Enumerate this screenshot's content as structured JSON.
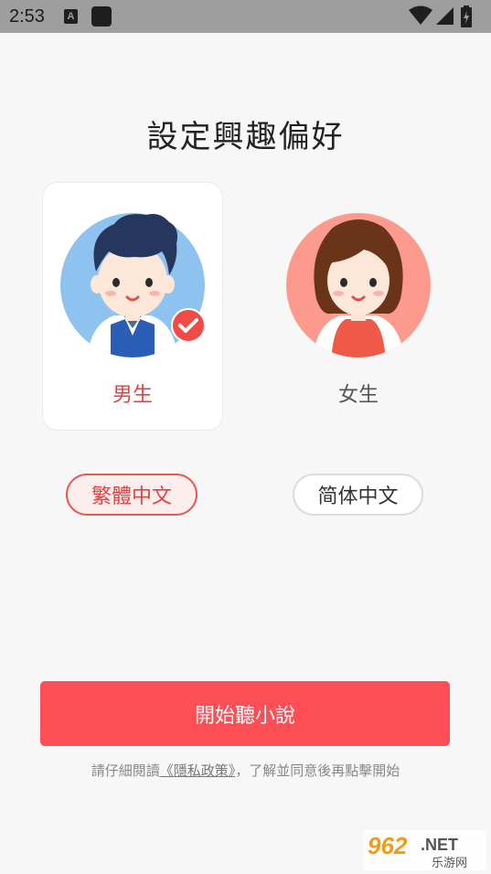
{
  "status_bar": {
    "time": "2:53",
    "notif_letter": "A"
  },
  "page": {
    "title": "設定興趣偏好"
  },
  "gender": {
    "male_label": "男生",
    "female_label": "女生",
    "selected": "male"
  },
  "language": {
    "traditional_label": "繁體中文",
    "simplified_label": "简体中文",
    "selected": "traditional"
  },
  "start_button": {
    "label": "開始聽小說"
  },
  "policy": {
    "prefix": "請仔細閱讀",
    "link": "《隱私政策》",
    "suffix": "，了解並同意後再點擊開始"
  },
  "watermark": {
    "text": "962.NET",
    "subtext": "乐游网"
  },
  "colors": {
    "accent": "#fd4f55",
    "selected_text": "#e4413f",
    "status_bar": "#9e9e9e"
  }
}
